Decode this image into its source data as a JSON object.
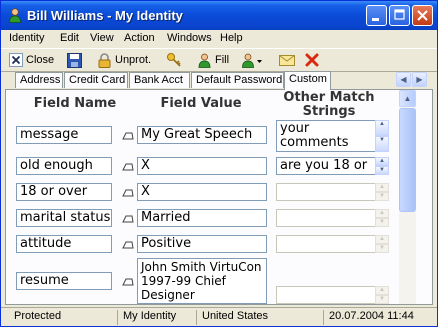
{
  "window": {
    "title": "Bill Williams - My Identity"
  },
  "menu": [
    "Identity",
    "Edit",
    "View",
    "Action",
    "Windows",
    "Help"
  ],
  "toolbar": {
    "close_label": "Close",
    "unprotect_label": "Unprot.",
    "fill_label": "Fill"
  },
  "tabs": [
    "Address",
    "Credit Card",
    "Bank Acct",
    "Default Password",
    "Custom"
  ],
  "active_tab": "Custom",
  "headers": {
    "field_name": "Field Name",
    "field_value": "Field Value",
    "other_match_1": "Other Match",
    "other_match_2": "Strings"
  },
  "rows": [
    {
      "name": "message",
      "value": "My Great Speech",
      "match": "your comments"
    },
    {
      "name": "old enough",
      "value": "X",
      "match": "are you 18 or"
    },
    {
      "name": "18 or over",
      "value": "X",
      "match": ""
    },
    {
      "name": "marital status",
      "value": "Married",
      "match": ""
    },
    {
      "name": "attitude",
      "value": "Positive",
      "match": ""
    },
    {
      "name": "resume",
      "value": "John Smith VirtuCon 1997-99 Chief Designer",
      "match": ""
    }
  ],
  "status": {
    "protection": "Protected",
    "identity": "My Identity",
    "country": "United States",
    "datetime": "20.07.2004 11:44"
  },
  "colors": {
    "titlebar": "#0a4bd7",
    "window_bg": "#ece9d8",
    "panel_bg": "#fcfcfe",
    "field_border": "#7f9db9"
  }
}
